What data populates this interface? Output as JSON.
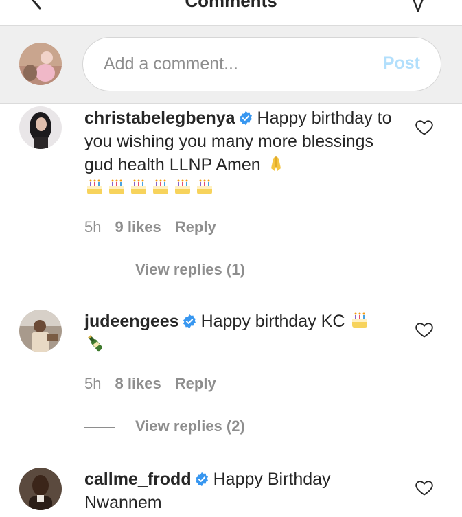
{
  "header": {
    "title": "Comments",
    "back_icon": "chevron-left-icon",
    "send_icon": "send-icon"
  },
  "composer": {
    "placeholder": "Add a comment...",
    "post_label": "Post"
  },
  "comments": [
    {
      "username": "christabelegbenya",
      "text_line1": "Happy birthday",
      "text_rest": "to you wishing you many more blessings gud health LLNP Amen",
      "emojis": [
        "pray",
        "cake",
        "cake",
        "cake",
        "cake",
        "cake",
        "cake"
      ],
      "time": "5h",
      "likes": "9 likes",
      "reply": "Reply",
      "view_replies": "View replies (1)"
    },
    {
      "username": "judeengees",
      "text_line1": "Happy birthday KC",
      "emojis": [
        "cake",
        "champagne"
      ],
      "time": "5h",
      "likes": "8 likes",
      "reply": "Reply",
      "view_replies": "View replies (2)"
    },
    {
      "username": "callme_frodd",
      "text_line1": "Happy Birthday",
      "text_rest": "Nwannem"
    }
  ],
  "colors": {
    "verified": "#3897f0",
    "post_disabled": "#b2dffc",
    "meta": "#8e8e8e",
    "composer_bg": "#efefef"
  }
}
